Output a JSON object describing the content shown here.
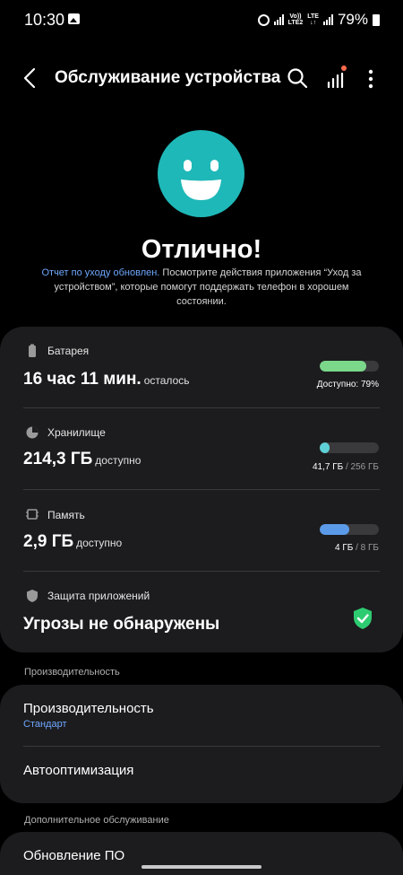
{
  "status_bar": {
    "time": "10:30",
    "net_top": "Vo))",
    "net_bottom": "LTE2",
    "lte_top": "LTE",
    "lte_bottom": "↓↑",
    "battery_percent": "79%",
    "battery_level": 0.79
  },
  "header": {
    "title": "Обслуживание устройства"
  },
  "hero": {
    "status": "Отлично!",
    "link_text": "Отчет по уходу обновлен.",
    "description": " Посмотрите действия приложения “Уход за устройством”, которые помогут поддержать телефон в хорошем состоянии."
  },
  "battery": {
    "label": "Батарея",
    "value": "16 час 11 мин.",
    "sub": "осталось",
    "caption": "Доступно: 79%",
    "fill": 0.79,
    "color": "#7bd88a"
  },
  "storage": {
    "label": "Хранилище",
    "value": "214,3 ГБ",
    "sub": "доступно",
    "used": "41,7 ГБ",
    "sep": " / ",
    "total": "256 ГБ",
    "fill": 0.163,
    "color": "#5fd0d5"
  },
  "memory": {
    "label": "Память",
    "value": "2,9 ГБ",
    "sub": "доступно",
    "used": "4 ГБ",
    "sep": " / ",
    "total": "8 ГБ",
    "fill": 0.5,
    "color": "#5b9ae8"
  },
  "protection": {
    "label": "Защита приложений",
    "value": "Угрозы не обнаружены",
    "color": "#2ecc71"
  },
  "performance_section": {
    "header": "Производительность",
    "items": [
      {
        "title": "Производительность",
        "sub": "Стандарт"
      },
      {
        "title": "Автооптимизация"
      }
    ]
  },
  "extra_section": {
    "header": "Дополнительное обслуживание",
    "items": [
      {
        "title": "Обновление ПО"
      }
    ]
  },
  "colors": {
    "accent": "#1fb8b8",
    "link": "#6ea7ff",
    "card": "#1c1c1e",
    "notification_dot": "#ff6a4d"
  },
  "icons": [
    "gallery-icon",
    "alarm-icon",
    "signal-icon",
    "back-arrow-icon",
    "search-icon",
    "stats-icon",
    "more-icon",
    "smiley-icon",
    "battery-icon",
    "storage-icon",
    "memory-icon",
    "shield-icon",
    "shield-check-icon"
  ]
}
